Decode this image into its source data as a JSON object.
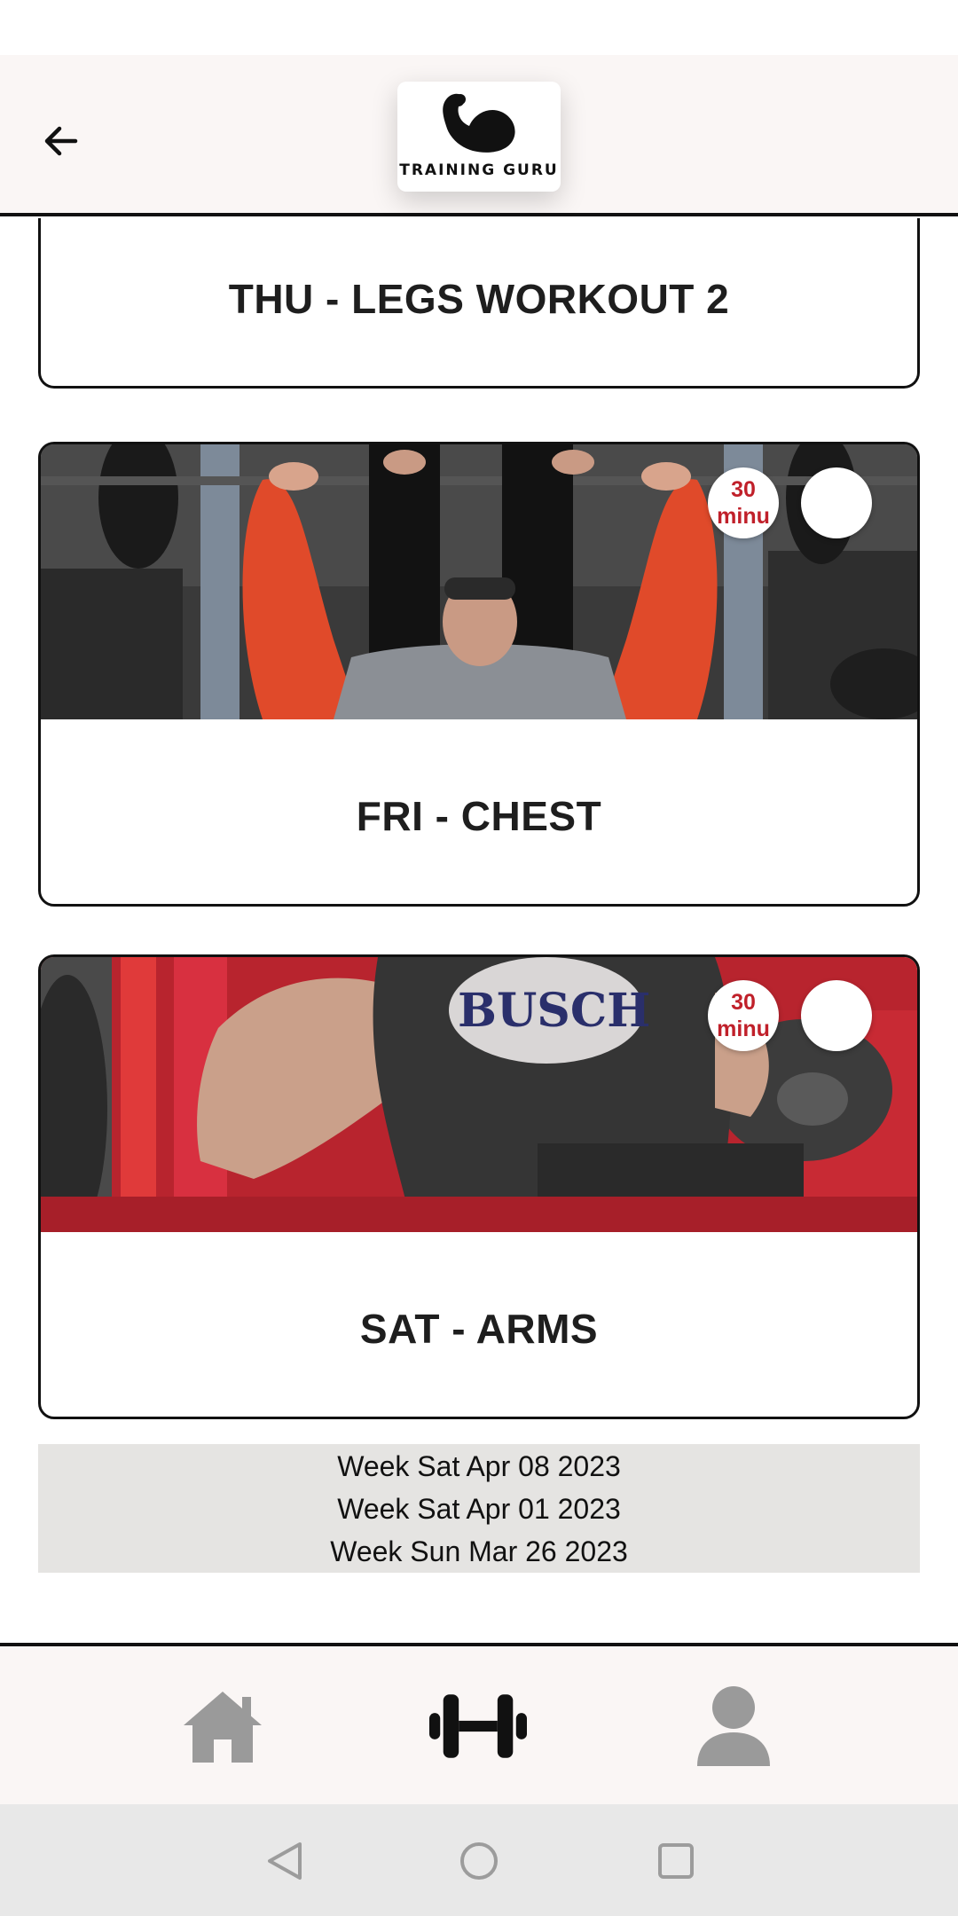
{
  "header": {
    "back_icon": "arrow-left-icon",
    "logo_text": "TRAINING GURU",
    "logo_icon": "flexed-bicep-icon"
  },
  "workouts": [
    {
      "title": "THU - LEGS WORKOUT 2"
    },
    {
      "title": "FRI - CHEST",
      "duration_line1": "30",
      "duration_line2": "minu",
      "image": "bench-press-photo"
    },
    {
      "title": "SAT - ARMS",
      "duration_line1": "30",
      "duration_line2": "minu",
      "image": "arm-curl-photo"
    }
  ],
  "weeks": [
    "Week Sat Apr 08 2023",
    "Week Sat Apr 01 2023",
    "Week Sun Mar 26 2023"
  ],
  "bottom_nav": {
    "items": [
      {
        "icon": "home-icon",
        "active": false
      },
      {
        "icon": "dumbbell-icon",
        "active": true
      },
      {
        "icon": "person-icon",
        "active": false
      }
    ]
  },
  "colors": {
    "header_bg": "#faf6f5",
    "badge_text": "#c0202a",
    "week_list_bg": "#e5e4e2",
    "nav_inactive": "#9a9a9a",
    "nav_active": "#111111"
  }
}
